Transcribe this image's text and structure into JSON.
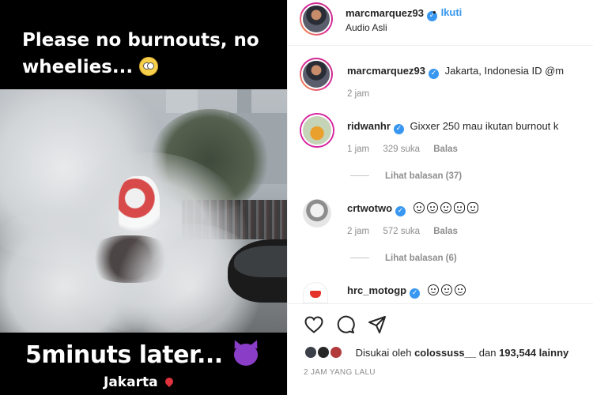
{
  "media": {
    "caption_top": "Please no burnouts, no wheelies...",
    "caption_bottom": "5minuts later...",
    "location": "Jakarta"
  },
  "header": {
    "username": "marcmarquez93",
    "follow_label": "Ikuti",
    "audio_label": "Audio Asli"
  },
  "post": {
    "username": "marcmarquez93",
    "text": "Jakarta, Indonesia ID @m",
    "time": "2 jam"
  },
  "comments": [
    {
      "username": "ridwanhr",
      "text": "Gixxer 250 mau ikutan burnout k",
      "time": "1 jam",
      "likes": "329 suka",
      "reply_label": "Balas",
      "view_replies": "Lihat balasan (37)"
    },
    {
      "username": "crtwotwo",
      "time": "2 jam",
      "likes": "572 suka",
      "reply_label": "Balas",
      "view_replies": "Lihat balasan (6)"
    },
    {
      "username": "hrc_motogp"
    }
  ],
  "footer": {
    "liked_prefix": "Disukai oleh",
    "liked_user": "colossuss__",
    "liked_joiner": "dan",
    "liked_count": "193,544 lainny",
    "timestamp": "2 JAM YANG LALU"
  },
  "colors": {
    "accent": "#3897f0",
    "muted": "#8e8e8e",
    "text": "#262626"
  }
}
